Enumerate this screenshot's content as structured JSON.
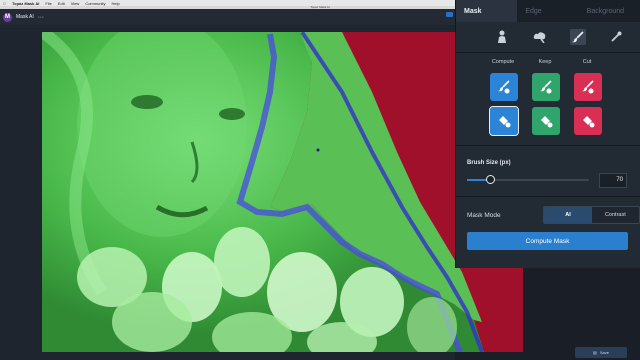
{
  "menubar": {
    "app_name": "Topaz Mask AI",
    "items": [
      "File",
      "Edit",
      "View",
      "Community",
      "Help"
    ]
  },
  "window": {
    "title": "Topaz Mask AI"
  },
  "appbar": {
    "name": "Mask AI",
    "version": "v1.0"
  },
  "panel": {
    "tabs": [
      {
        "label": "Mask",
        "active": true
      },
      {
        "label": "Edge",
        "active": false
      },
      {
        "label": "Background",
        "active": false
      }
    ],
    "tools": [
      "person-brush-icon",
      "cloud-brush-icon",
      "brush-icon",
      "eyedropper-icon"
    ],
    "column_heads": {
      "compute": "Compute",
      "keep": "Keep",
      "cut": "Cut"
    },
    "brush_size": {
      "label": "Brush Size (px)",
      "value": "70",
      "level": 0.19
    },
    "mask_mode": {
      "label": "Mask Mode",
      "options": [
        "AI",
        "Contrast"
      ],
      "selected": "AI"
    },
    "compute_button": "Compute Mask"
  },
  "footer": {
    "save_label": "Save"
  },
  "colors": {
    "compute": "#2b84d6",
    "keep": "#31a46b",
    "cut": "#d92f54",
    "mask_keep": "#3fc43f",
    "mask_cut": "#a0102a",
    "mask_edge": "#3a3ad8"
  }
}
